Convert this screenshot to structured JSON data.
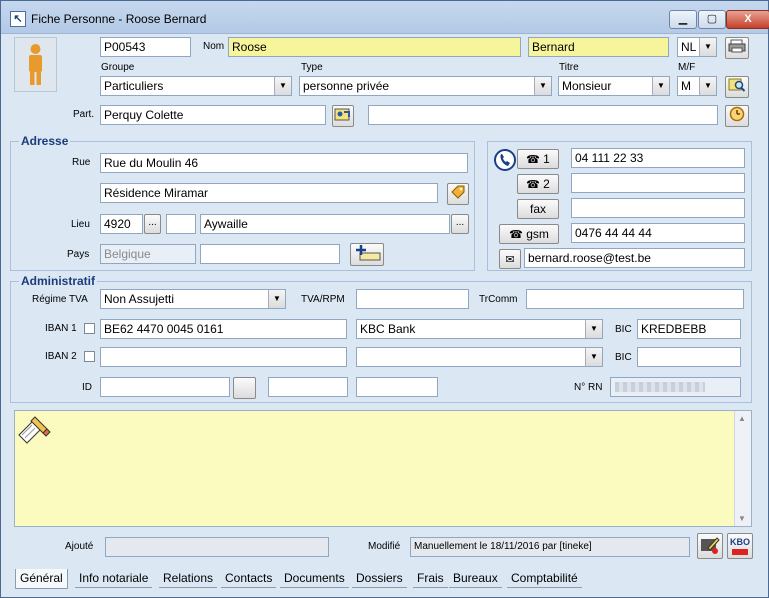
{
  "window": {
    "title": "Fiche Personne - Roose Bernard",
    "controls": {
      "min": "▭",
      "max": "▢",
      "close": "X"
    }
  },
  "person": {
    "id": "P00543",
    "nom_label": "Nom",
    "nom": "Roose",
    "prenom": "Bernard",
    "langue": "NL",
    "groupe_label": "Groupe",
    "groupe": "Particuliers",
    "type_label": "Type",
    "type": "personne privée",
    "titre_label": "Titre",
    "titre": "Monsieur",
    "mf_label": "M/F",
    "mf": "M",
    "part_label": "Part.",
    "partenaire": "Perquy Colette",
    "partenaire_extra": ""
  },
  "adresse": {
    "title": "Adresse",
    "rue_label": "Rue",
    "rue": "Rue du Moulin 46",
    "rue2": "Résidence Miramar",
    "lieu_label": "Lieu",
    "cp": "4920",
    "dots": "...",
    "localite": "Aywaille",
    "pays_label": "Pays",
    "pays": "Belgique",
    "pays_extra": ""
  },
  "contact": {
    "tel1_label": "1",
    "tel1": "04 111 22 33",
    "tel2_label": "2",
    "tel2": "",
    "fax_label": "fax",
    "fax": "",
    "gsm_label": "gsm",
    "gsm": "0476 44 44 44",
    "email": "bernard.roose@test.be"
  },
  "admin": {
    "title": "Administratif",
    "regime_label": "Régime TVA",
    "regime": "Non Assujetti",
    "tvarpm_label": "TVA/RPM",
    "tvarpm": "",
    "trcomm_label": "TrComm",
    "trcomm": "",
    "iban1_label": "IBAN 1",
    "iban1": "BE62 4470 0045 0161",
    "bank1": "KBC Bank",
    "bic1_label": "BIC",
    "bic1": "KREDBEBB",
    "iban2_label": "IBAN 2",
    "iban2": "",
    "bank2": "",
    "bic2_label": "BIC",
    "bic2": "",
    "id_label": "ID",
    "id1": "",
    "id2": "",
    "id3": "",
    "rn_label": "N° RN"
  },
  "footer": {
    "ajoute_label": "Ajouté",
    "ajoute": "",
    "modifie_label": "Modifié",
    "modifie": "Manuellement le 18/11/2016 par [tineke]",
    "kbo": "KBO"
  },
  "tabs": [
    "Général",
    "Info notariale",
    "Relations",
    "Contacts",
    "Documents",
    "Dossiers",
    "Frais",
    "Bureaux",
    "Comptabilité"
  ],
  "colors": {
    "yellow_field": "#f7f59c",
    "notes_bg": "#fbfbc0",
    "panel_bg": "#dbe7f3",
    "group_title": "#1a3d7c"
  }
}
